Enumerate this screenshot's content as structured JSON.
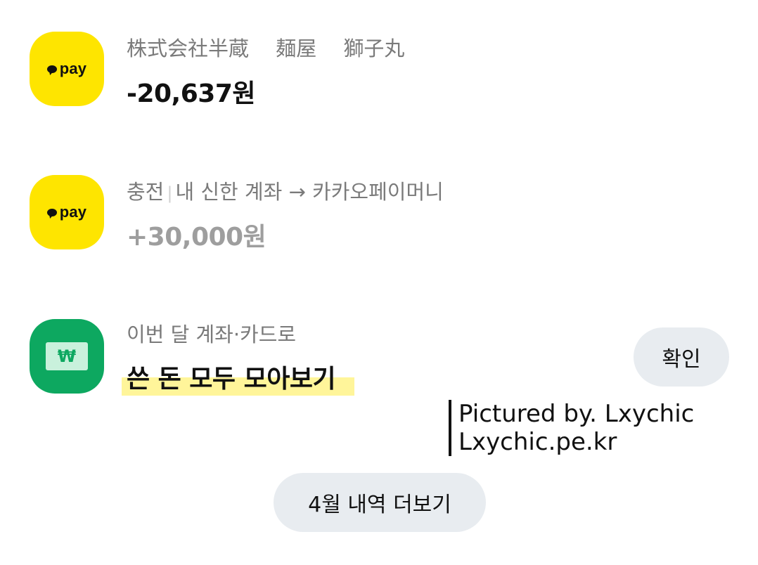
{
  "transactions": [
    {
      "icon": "kakaopay-icon",
      "logo_text": "pay",
      "description": "株式会社半蔵　 麺屋　 獅子丸",
      "amount": "-20,637원"
    },
    {
      "icon": "kakaopay-icon",
      "logo_text": "pay",
      "category": "충전",
      "description": "내 신한 계좌 → 카카오페이머니",
      "amount": "+30,000원"
    }
  ],
  "promo": {
    "icon": "won-card-icon",
    "won_symbol": "₩",
    "subtitle": "이번 달 계좌·카드로",
    "title": "쓴 돈 모두 모아보기",
    "confirm_label": "확인"
  },
  "watermark": {
    "line1": "Pictured by. Lxychic",
    "line2": "Lxychic.pe.kr"
  },
  "more_button": "4월 내역 더보기",
  "colors": {
    "kakao_yellow": "#FEE500",
    "green": "#0DA860",
    "highlight": "#FFF59A",
    "pill_bg": "#E8ECF0"
  }
}
